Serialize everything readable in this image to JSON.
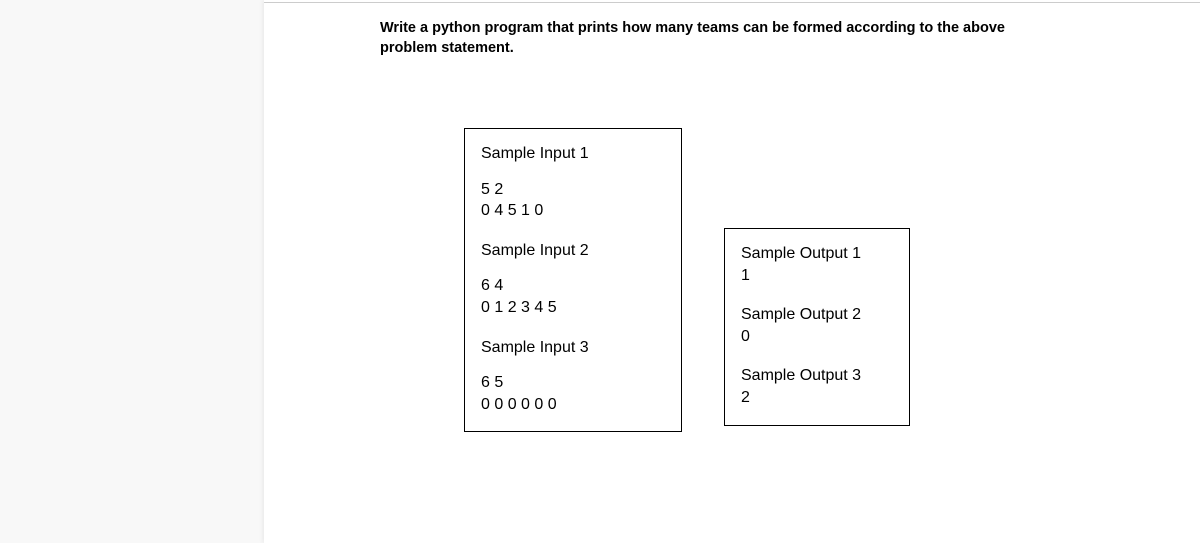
{
  "problem": {
    "statement": "Write a python program that prints how many teams can be formed according to the above problem statement."
  },
  "samples": {
    "inputs": [
      {
        "header": "Sample Input 1",
        "line1": "5 2",
        "line2": "0 4 5 1 0"
      },
      {
        "header": "Sample Input 2",
        "line1": "6 4",
        "line2": "0 1 2 3 4 5"
      },
      {
        "header": "Sample Input 3",
        "line1": "6 5",
        "line2": "0 0 0 0 0 0"
      }
    ],
    "outputs": [
      {
        "header": "Sample Output 1",
        "value": "1"
      },
      {
        "header": "Sample Output 2",
        "value": "0"
      },
      {
        "header": "Sample Output 3",
        "value": "2"
      }
    ]
  }
}
